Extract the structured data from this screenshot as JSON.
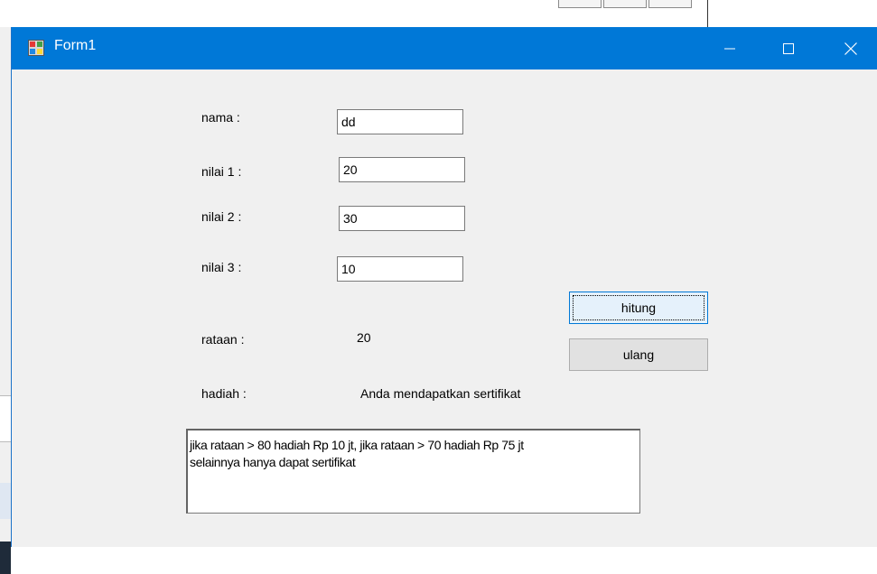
{
  "window": {
    "title": "Form1",
    "controls": {
      "minimize": "minimize",
      "maximize": "maximize",
      "close": "close"
    }
  },
  "form": {
    "nama_label": "nama :",
    "nama_value": "dd",
    "nilai1_label": "nilai 1 :",
    "nilai1_value": "20",
    "nilai2_label": "nilai 2 :",
    "nilai2_value": "30",
    "nilai3_label": "nilai 3 :",
    "nilai3_value": "10",
    "rataan_label": "rataan :",
    "rataan_value": "20",
    "hadiah_label": "hadiah :",
    "hadiah_value": "Anda mendapatkan sertifikat",
    "hitung_button": "hitung",
    "ulang_button": "ulang",
    "info_line1": "jika rataan > 80 hadiah Rp 10 jt, jika rataan > 70 hadiah Rp 75 jt",
    "info_line2": "selainnya hanya dapat sertifikat"
  },
  "colors": {
    "titlebar": "#0078d7",
    "form_bg": "#f0f0f0",
    "button_focus_bg": "#e5f1fb"
  }
}
